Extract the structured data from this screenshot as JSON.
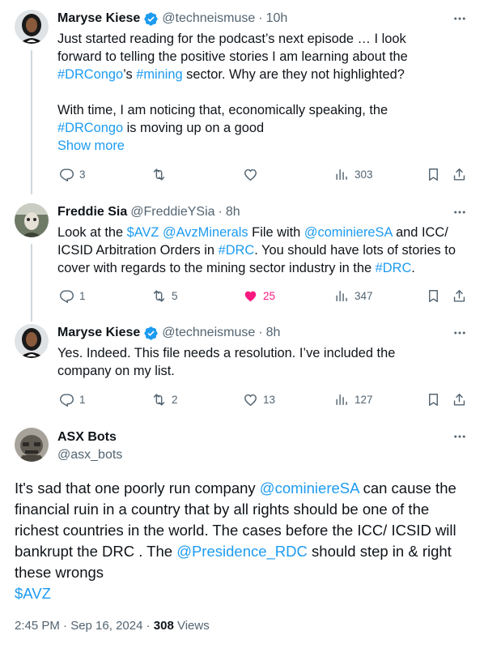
{
  "tweets": [
    {
      "name": "Maryse Kiese",
      "handle": "@techneismuse",
      "time": "10h",
      "verified": true,
      "text_lines": {
        "l1": "Just started reading for the podcast’s next episode … I look",
        "l2": "forward to telling the positive stories I am learning about the",
        "l3_tag1": "#DRCongo",
        "l3_mid": "’s ",
        "l3_tag2": "#mining",
        "l3_end": " sector. Why are they not highlighted?",
        "l4": "With time, I am noticing that, economically speaking, the",
        "l5_tag": "#DRCongo",
        "l5_end": " is moving up on a good"
      },
      "show_more": "Show more",
      "replies": "3",
      "retweets": "",
      "likes": "",
      "views": "303"
    },
    {
      "name": "Freddie Sia",
      "handle": "@FreddieYSia",
      "time": "8h",
      "verified": false,
      "text_parts": {
        "p1": "Look at the ",
        "c1": "$AVZ",
        "p2": " ",
        "m1": "@AvzMinerals",
        "p3": " File with ",
        "m2": "@cominiereSA",
        "p4": " and ICC/ ICSID Arbitration Orders in ",
        "h1": "#DRC",
        "p5": ". You should have lots of stories to cover with regards to the mining sector industry in the ",
        "h2": "#DRC",
        "p6": "."
      },
      "replies": "1",
      "retweets": "5",
      "likes": "25",
      "views": "347"
    },
    {
      "name": "Maryse Kiese",
      "handle": "@techneismuse",
      "time": "8h",
      "verified": true,
      "text": "Yes. Indeed. This file needs a resolution. I’ve included the company on my list.",
      "replies": "1",
      "retweets": "2",
      "likes": "13",
      "views": "127"
    }
  ],
  "main_tweet": {
    "name": "ASX Bots",
    "handle": "@asx_bots",
    "text_parts": {
      "p1": "It's sad that one poorly run company ",
      "m1": "@cominiereSA",
      "p2": " can cause the financial ruin in a country that by all rights should be one of the richest countries in the world. The cases before the ICC/ ICSID will bankrupt the DRC . The ",
      "m2": "@Presidence_RDC",
      "p3": " should step in & right these wrongs",
      "c1": "$AVZ"
    },
    "timestamp": "2:45 PM · Sep 16, 2024 · ",
    "views_count": "308",
    "views_label": " Views"
  },
  "colors": {
    "link": "#1d9bf0",
    "muted": "#536471",
    "like_active": "#f91880",
    "verified_badge": "#1d9bf0"
  },
  "icons": [
    "reply-icon",
    "retweet-icon",
    "like-icon",
    "views-icon",
    "bookmark-icon",
    "share-icon",
    "more-icon",
    "verified-icon"
  ]
}
